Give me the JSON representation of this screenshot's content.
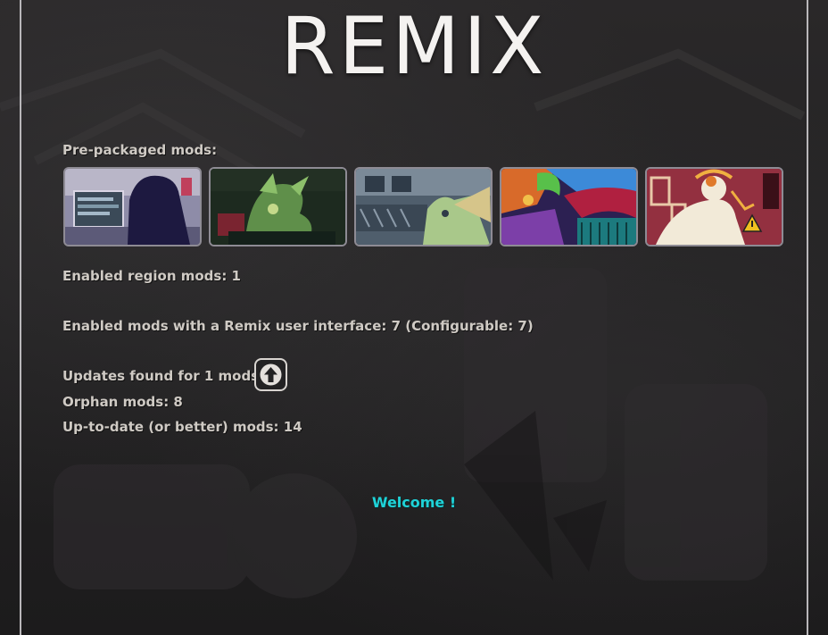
{
  "title": "REMIX",
  "prepackaged_label": "Pre-packaged mods:",
  "thumbnails": [
    {
      "name": "mod-thumbnail-1",
      "icon": "laptop-silhouette-scene"
    },
    {
      "name": "mod-thumbnail-2",
      "icon": "green-creature-scene"
    },
    {
      "name": "mod-thumbnail-3",
      "icon": "blue-station-scene"
    },
    {
      "name": "mod-thumbnail-4",
      "icon": "colorful-chaos-scene"
    },
    {
      "name": "mod-thumbnail-5",
      "icon": "warning-sign-scene"
    }
  ],
  "stats": {
    "region_mods": "Enabled region mods: 1",
    "remix_interface": "Enabled mods with a Remix user interface: 7 (Configurable: 7)",
    "updates": "Updates found for 1 mods",
    "orphan": "Orphan mods: 8",
    "up_to_date": "Up-to-date (or better) mods: 14"
  },
  "update_icon": "arrow-up-icon",
  "welcome": "Welcome !",
  "colors": {
    "accent": "#1fd3d8",
    "text": "#cfcac4",
    "frame": "#b9b7ba"
  }
}
